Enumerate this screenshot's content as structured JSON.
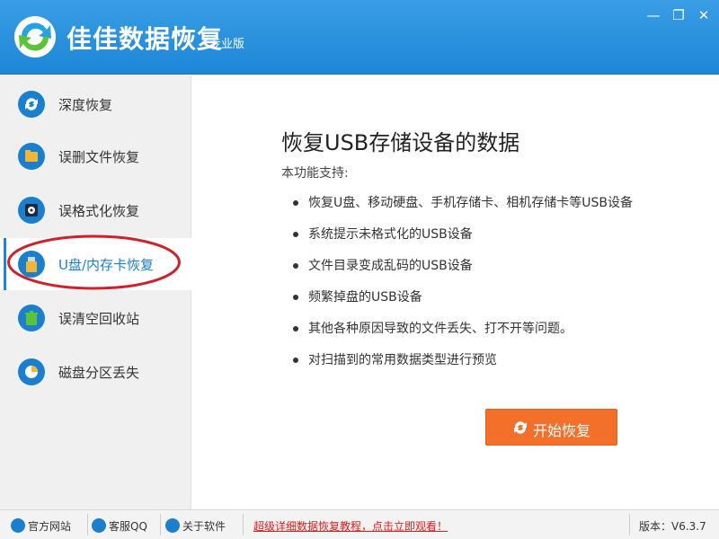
{
  "app": {
    "title": "佳佳数据恢复",
    "edition": "专业版",
    "minimize": "—",
    "maximize": "❐",
    "close": "✕"
  },
  "sidebar": {
    "items": [
      {
        "label": "深度恢复",
        "icon": "refresh-icon"
      },
      {
        "label": "误删文件恢复",
        "icon": "folder-icon"
      },
      {
        "label": "误格式化恢复",
        "icon": "disk-icon"
      },
      {
        "label": "U盘/内存卡恢复",
        "icon": "usb-icon",
        "active": true
      },
      {
        "label": "误清空回收站",
        "icon": "recycle-bin-icon"
      },
      {
        "label": "磁盘分区丢失",
        "icon": "pie-chart-icon"
      }
    ]
  },
  "main": {
    "heading": "恢复USB存储设备的数据",
    "subtitle": "本功能支持:",
    "features": [
      "恢复U盘、移动硬盘、手机存储卡、相机存储卡等USB设备",
      "系统提示未格式化的USB设备",
      "文件目录变成乱码的USB设备",
      "频繁掉盘的USB设备",
      "其他各种原因导致的文件丢失、打不开等问题。",
      "对扫描到的常用数据类型进行预览"
    ],
    "start_button": "开始恢复"
  },
  "statusbar": {
    "official_site": "官方网站",
    "support_qq": "客服QQ",
    "about": "关于软件",
    "promo": "超级详细数据恢复教程，点击立即观看！",
    "version": "版本：V6.3.7"
  },
  "colors": {
    "title_bar": "#2391de",
    "accent": "#1b7fcd",
    "start_button": "#f3702a",
    "highlight_ellipse": "#d0202a",
    "promo_text": "#e01b1b"
  }
}
